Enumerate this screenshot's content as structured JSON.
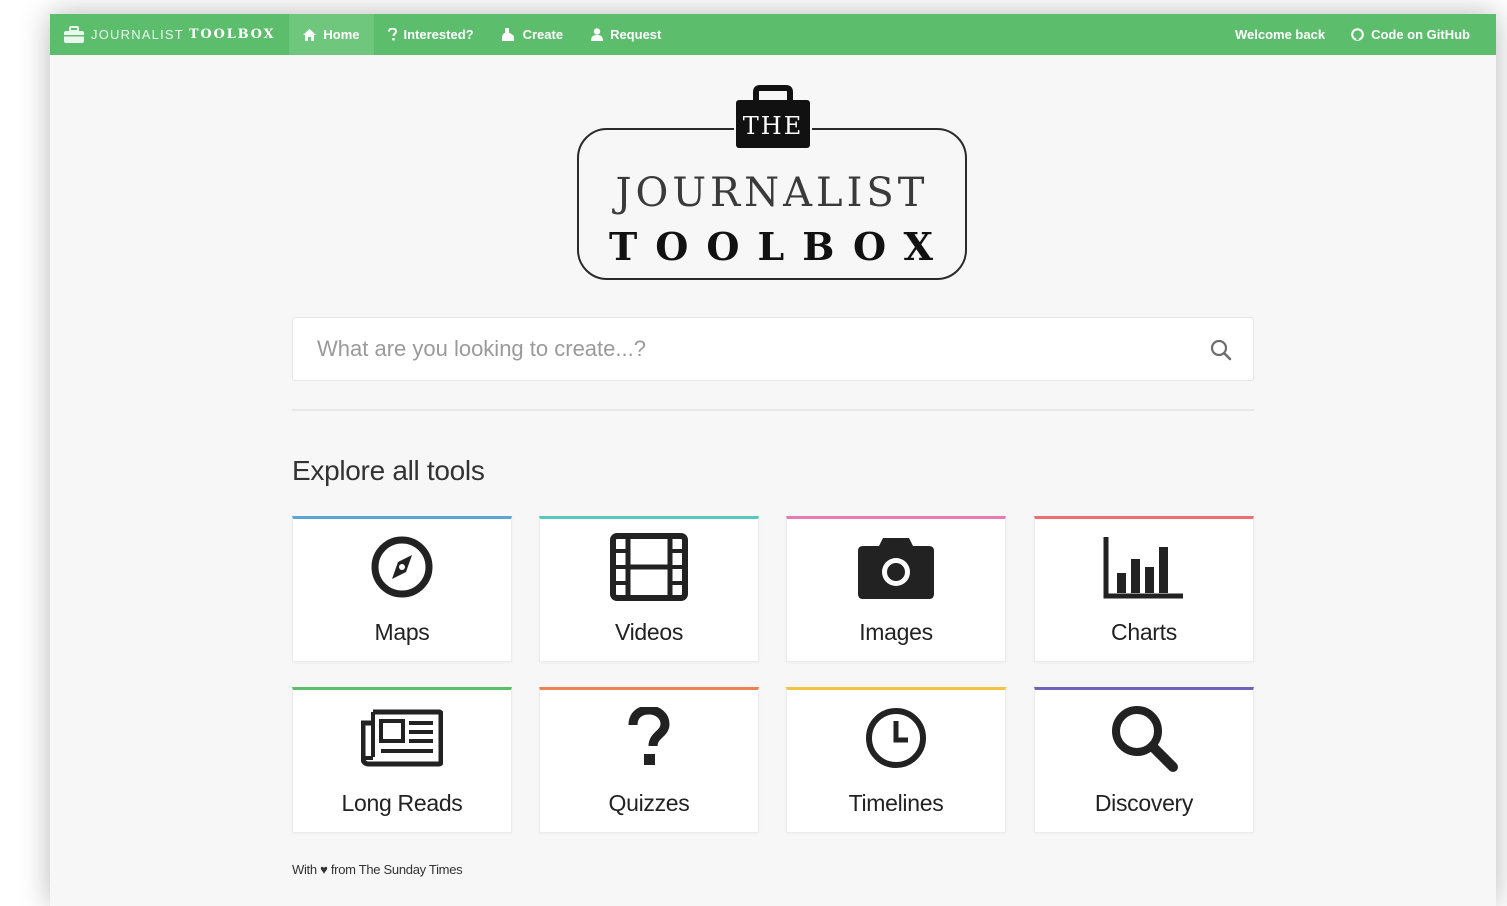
{
  "navbar": {
    "brand_light": "JOURNALIST",
    "brand_bold": "TOOLBOX",
    "brand_icon": "briefcase-icon",
    "links": [
      {
        "label": "Home",
        "icon": "home-icon",
        "active": true
      },
      {
        "label": "Interested?",
        "icon": "question-icon",
        "active": false
      },
      {
        "label": "Create",
        "icon": "flask-icon",
        "active": false
      },
      {
        "label": "Request",
        "icon": "user-icon",
        "active": false
      }
    ],
    "right": [
      {
        "label": "Welcome back"
      },
      {
        "label": "Code on GitHub",
        "icon": "github-icon"
      }
    ],
    "color": "#5cbd6d"
  },
  "logo": {
    "the": "THE",
    "journalist": "JOURNALIST",
    "toolbox": "TOOLBOX"
  },
  "search": {
    "placeholder": "What are you looking to create...?",
    "value": "",
    "icon": "search-icon"
  },
  "section_title": "Explore all tools",
  "tools": [
    {
      "label": "Maps",
      "icon": "compass-icon",
      "color": "#5aa6d6"
    },
    {
      "label": "Videos",
      "icon": "film-icon",
      "color": "#55c8c0"
    },
    {
      "label": "Images",
      "icon": "camera-icon",
      "color": "#e87ab8"
    },
    {
      "label": "Charts",
      "icon": "bar-chart-icon",
      "color": "#ee6e73"
    },
    {
      "label": "Long Reads",
      "icon": "newspaper-icon",
      "color": "#5cbd6d"
    },
    {
      "label": "Quizzes",
      "icon": "question-icon",
      "color": "#ee8155"
    },
    {
      "label": "Timelines",
      "icon": "clock-icon",
      "color": "#f2c43f"
    },
    {
      "label": "Discovery",
      "icon": "search-icon",
      "color": "#6e63b5"
    }
  ],
  "footer": {
    "prefix": "With",
    "heart": "♥",
    "suffix": "from The Sunday Times"
  }
}
